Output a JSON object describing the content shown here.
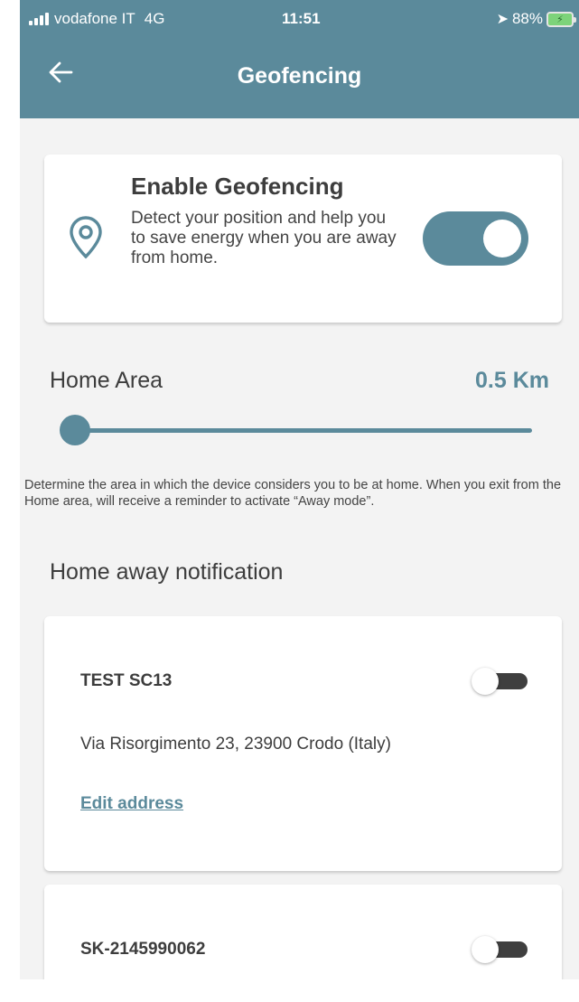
{
  "status_bar": {
    "carrier": "vodafone IT",
    "network": "4G",
    "time": "11:51",
    "location_icon": "location-arrow-icon",
    "battery": "88%"
  },
  "header": {
    "title": "Geofencing",
    "back_icon": "back-arrow-icon"
  },
  "enable_card": {
    "title": "Enable Geofencing",
    "description": "Detect your position and help you to save energy when you are away from home.",
    "icon": "location-pin-icon",
    "enabled": true
  },
  "home_area": {
    "label": "Home Area",
    "value": "0.5 Km",
    "slider_fraction": 0,
    "hint": "Determine the area in which the device considers you to be at home. When you exit from the Home area, will receive a reminder to activate “Away mode”."
  },
  "notifications": {
    "title": "Home away notification",
    "devices": [
      {
        "name": "TEST SC13",
        "address": "Via Risorgimento 23, 23900 Crodo (Italy)",
        "edit_label": "Edit address",
        "enabled": false
      },
      {
        "name": "SK-2145990062",
        "enabled": false
      }
    ]
  },
  "colors": {
    "accent": "#5b8a9b",
    "background": "#f3f3f3",
    "card": "#ffffff",
    "toggle_off": "#3f3f3f"
  }
}
